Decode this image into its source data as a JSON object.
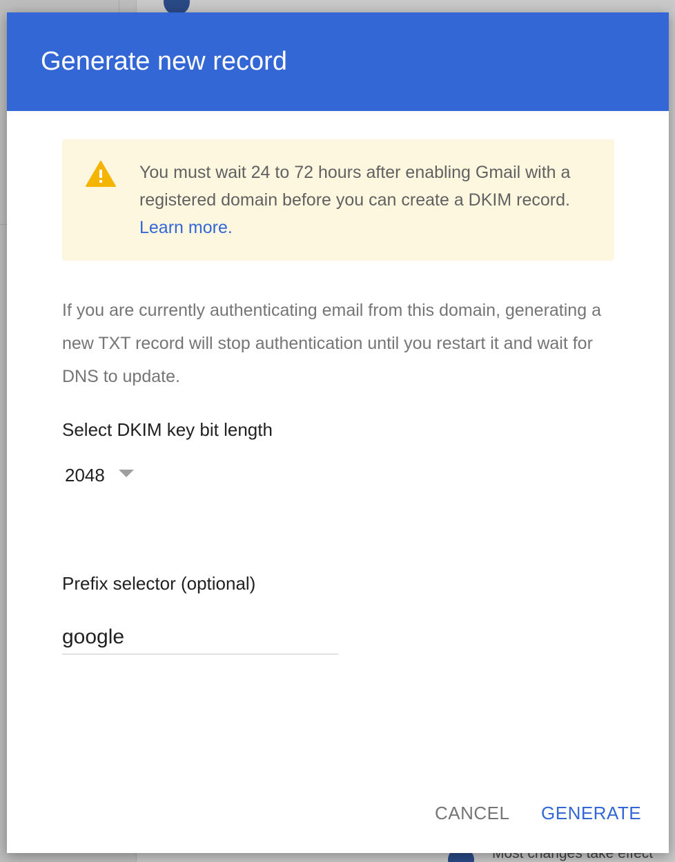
{
  "background": {
    "bottom_text": "Most changes take effect"
  },
  "dialog": {
    "title": "Generate new record",
    "warning": {
      "icon": "warning-triangle-icon",
      "text": "You must wait 24 to 72 hours after enabling Gmail with a registered domain before you can create a DKIM record.",
      "link": "Learn more."
    },
    "info_text": "If you are currently authenticating email from this domain, generating a new TXT record will stop authentication until you restart it and wait for DNS to update.",
    "key_length": {
      "label": "Select DKIM key bit length",
      "value": "2048"
    },
    "prefix": {
      "label": "Prefix selector (optional)",
      "value": "google"
    },
    "buttons": {
      "cancel": "CANCEL",
      "generate": "GENERATE"
    }
  },
  "colors": {
    "header": "#3367d6",
    "warning_bg": "#fef7e0",
    "warning_icon": "#f4b400",
    "link": "#3367d6"
  }
}
